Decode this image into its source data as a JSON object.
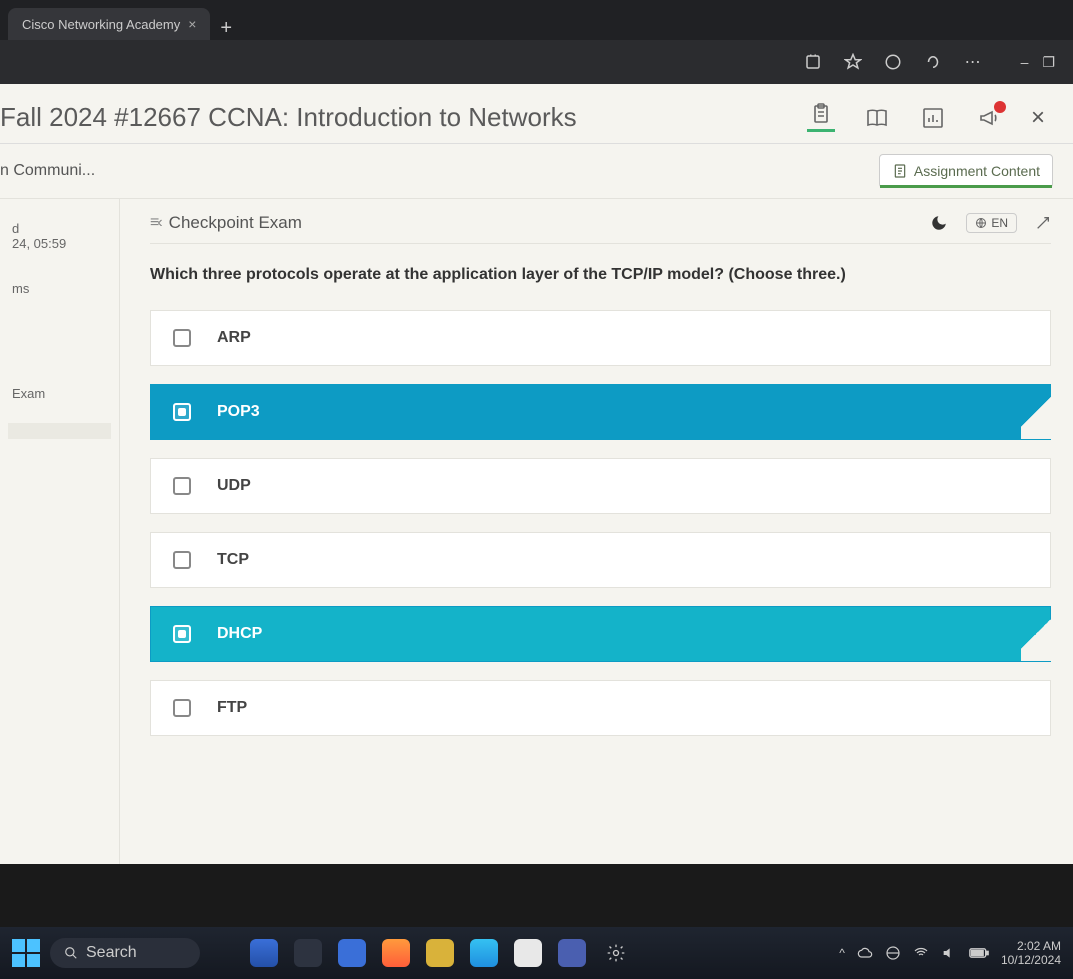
{
  "browser": {
    "tab_title": "Cisco Networking Academy",
    "window_buttons": {
      "min": "–",
      "restore": "❐",
      "close": ""
    }
  },
  "page": {
    "title": "Fall 2024 #12667 CCNA: Introduction to Networks",
    "breadcrumb": "n Communi...",
    "assignment_button": "Assignment Content"
  },
  "sidebar": {
    "items": [
      {
        "label": "d",
        "time": "24, 05:59"
      },
      {
        "label": "ms"
      },
      {
        "label": "Exam"
      },
      {
        "label": ""
      }
    ]
  },
  "exam": {
    "title": "Checkpoint Exam",
    "lang": "EN",
    "question": "Which three protocols operate at the application layer of the TCP/IP model? (Choose three.)",
    "options": [
      {
        "label": "ARP",
        "selected": false
      },
      {
        "label": "POP3",
        "selected": true
      },
      {
        "label": "UDP",
        "selected": false
      },
      {
        "label": "TCP",
        "selected": false
      },
      {
        "label": "DHCP",
        "selected": true
      },
      {
        "label": "FTP",
        "selected": false
      }
    ]
  },
  "taskbar": {
    "search_placeholder": "Search",
    "time": "2:02 AM",
    "date": "10/12/2024"
  }
}
